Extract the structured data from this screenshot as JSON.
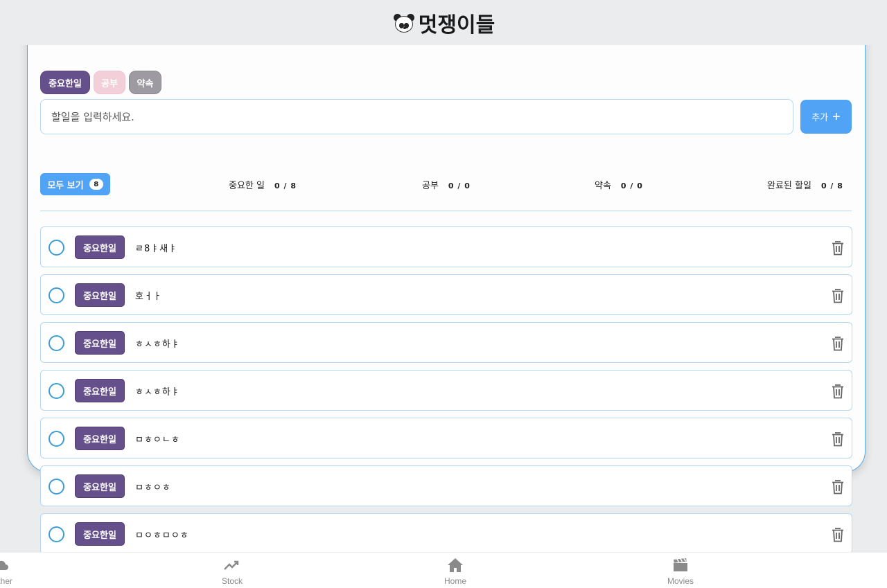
{
  "header": {
    "title": "멋쟁이들",
    "logo_icon": "panda-icon"
  },
  "category_chips": [
    {
      "label": "중요한일",
      "color": "#66508c"
    },
    {
      "label": "공부",
      "color": "#f2cfd9"
    },
    {
      "label": "약속",
      "color": "#9d9ba1"
    }
  ],
  "input": {
    "placeholder": "할일을 입력하세요.",
    "value": ""
  },
  "add_button": {
    "label": "추가",
    "icon": "plus-icon"
  },
  "filters": {
    "all": {
      "label": "모두 보기",
      "count": "8"
    },
    "important": {
      "label": "중요한 일",
      "ratio": "0 / 8"
    },
    "study": {
      "label": "공부",
      "ratio": "0 / 0"
    },
    "promise": {
      "label": "약속",
      "ratio": "0 / 0"
    },
    "done": {
      "label": "완료된 할일",
      "ratio": "0 / 8"
    }
  },
  "todos": [
    {
      "tag": "중요한일",
      "text": "ㄹ8ㅑ새ㅑ"
    },
    {
      "tag": "중요한일",
      "text": "호ㅓㅏ"
    },
    {
      "tag": "중요한일",
      "text": "ㅎㅅㅎ하ㅑ"
    },
    {
      "tag": "중요한일",
      "text": "ㅎㅅㅎ하ㅑ"
    },
    {
      "tag": "중요한일",
      "text": "ㅁㅎㅇㄴㅎ"
    },
    {
      "tag": "중요한일",
      "text": "ㅁㅎㅇㅎ"
    },
    {
      "tag": "중요한일",
      "text": "ㅁㅇㅎㅁㅇㅎ"
    }
  ],
  "bottom_nav": [
    {
      "label": "eather",
      "icon": "cloud-icon"
    },
    {
      "label": "Stock",
      "icon": "trending-up-icon"
    },
    {
      "label": "Home",
      "icon": "home-icon"
    },
    {
      "label": "Movies",
      "icon": "clapperboard-icon"
    }
  ],
  "colors": {
    "accent": "#51a3f6",
    "tag": "#66508c",
    "border": "#b6d6f2"
  }
}
